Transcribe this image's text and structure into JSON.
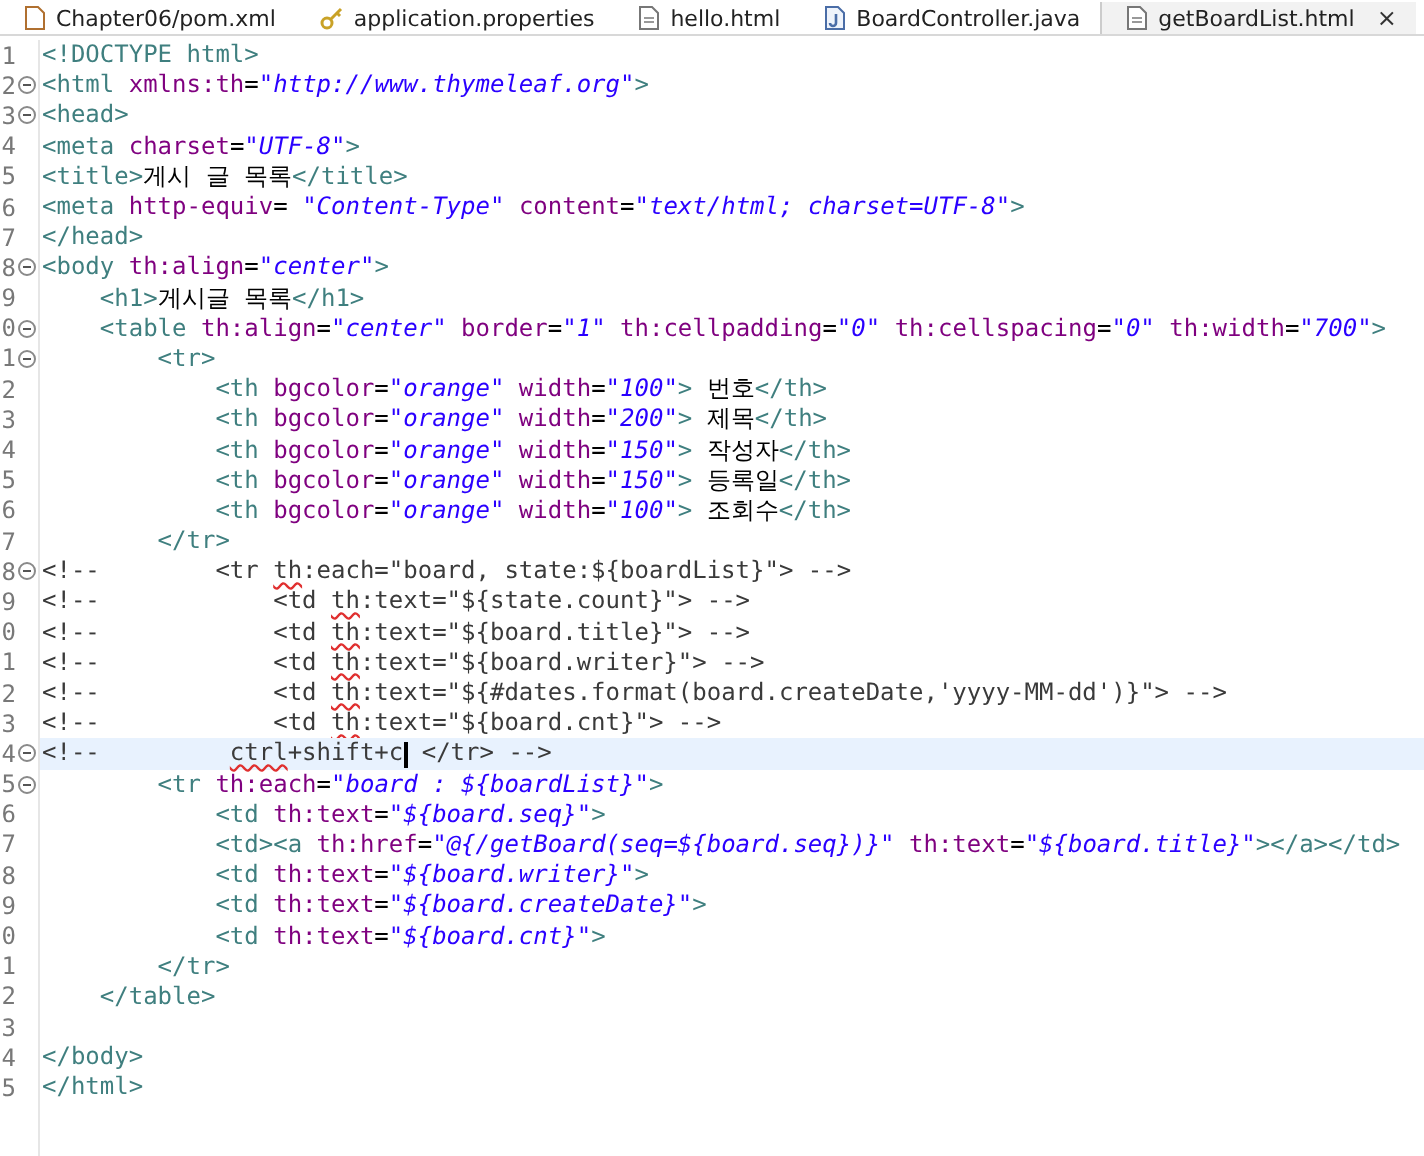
{
  "tabs": [
    {
      "label": "Chapter06/pom.xml",
      "kind": "xml",
      "selected": false
    },
    {
      "label": "application.properties",
      "kind": "properties",
      "selected": false
    },
    {
      "label": "hello.html",
      "kind": "html",
      "selected": false
    },
    {
      "label": "BoardController.java",
      "kind": "java",
      "selected": false
    },
    {
      "label": "getBoardList.html",
      "kind": "html",
      "selected": true,
      "close": "×"
    }
  ],
  "lines": [
    {
      "number": "1",
      "fold": false,
      "current": false,
      "tokens": [
        {
          "kind": "tag",
          "text": "<!DOCTYPE html>"
        }
      ]
    },
    {
      "number": "2",
      "fold": true,
      "current": false,
      "tokens": [
        {
          "kind": "tag",
          "text": "<html "
        },
        {
          "kind": "attr",
          "text": "xmlns:th"
        },
        {
          "kind": "text",
          "text": "="
        },
        {
          "kind": "value",
          "text": "\"http://www.thymeleaf.org\""
        },
        {
          "kind": "tag",
          "text": ">"
        }
      ]
    },
    {
      "number": "3",
      "fold": true,
      "current": false,
      "tokens": [
        {
          "kind": "tag",
          "text": "<head>"
        }
      ]
    },
    {
      "number": "4",
      "fold": false,
      "current": false,
      "tokens": [
        {
          "kind": "tag",
          "text": "<meta "
        },
        {
          "kind": "attr",
          "text": "charset"
        },
        {
          "kind": "text",
          "text": "="
        },
        {
          "kind": "value",
          "text": "\"UTF-8\""
        },
        {
          "kind": "tag",
          "text": ">"
        }
      ]
    },
    {
      "number": "5",
      "fold": false,
      "current": false,
      "tokens": [
        {
          "kind": "tag",
          "text": "<title>"
        },
        {
          "kind": "text",
          "text": "게시 글 목록"
        },
        {
          "kind": "tag",
          "text": "</title>"
        }
      ]
    },
    {
      "number": "6",
      "fold": false,
      "current": false,
      "tokens": [
        {
          "kind": "tag",
          "text": "<meta "
        },
        {
          "kind": "attr",
          "text": "http-equiv"
        },
        {
          "kind": "text",
          "text": "= "
        },
        {
          "kind": "value",
          "text": "\"Content-Type\""
        },
        {
          "kind": "attr",
          "text": " content"
        },
        {
          "kind": "text",
          "text": "="
        },
        {
          "kind": "value",
          "text": "\"text/html; charset=UTF-8\""
        },
        {
          "kind": "tag",
          "text": ">"
        }
      ]
    },
    {
      "number": "7",
      "fold": false,
      "current": false,
      "tokens": [
        {
          "kind": "tag",
          "text": "</head>"
        }
      ]
    },
    {
      "number": "8",
      "fold": true,
      "current": false,
      "tokens": [
        {
          "kind": "tag",
          "text": "<body "
        },
        {
          "kind": "attr",
          "text": "th:align"
        },
        {
          "kind": "text",
          "text": "="
        },
        {
          "kind": "value",
          "text": "\"center\""
        },
        {
          "kind": "tag",
          "text": ">"
        }
      ]
    },
    {
      "number": "9",
      "fold": false,
      "current": false,
      "tokens": [
        {
          "kind": "tag",
          "text": "    <h1>"
        },
        {
          "kind": "text",
          "text": "게시글 목록"
        },
        {
          "kind": "tag",
          "text": "</h1>"
        }
      ]
    },
    {
      "number": "0",
      "fold": true,
      "current": false,
      "tokens": [
        {
          "kind": "tag",
          "text": "    <table "
        },
        {
          "kind": "attr",
          "text": "th:align"
        },
        {
          "kind": "text",
          "text": "="
        },
        {
          "kind": "value",
          "text": "\"center\""
        },
        {
          "kind": "attr",
          "text": " border"
        },
        {
          "kind": "text",
          "text": "="
        },
        {
          "kind": "value",
          "text": "\"1\""
        },
        {
          "kind": "attr",
          "text": " th:cellpadding"
        },
        {
          "kind": "text",
          "text": "="
        },
        {
          "kind": "value",
          "text": "\"0\""
        },
        {
          "kind": "attr",
          "text": " th:cellspacing"
        },
        {
          "kind": "text",
          "text": "="
        },
        {
          "kind": "value",
          "text": "\"0\""
        },
        {
          "kind": "attr",
          "text": " th:width"
        },
        {
          "kind": "text",
          "text": "="
        },
        {
          "kind": "value",
          "text": "\"700\""
        },
        {
          "kind": "tag",
          "text": ">"
        }
      ]
    },
    {
      "number": "1",
      "fold": true,
      "current": false,
      "tokens": [
        {
          "kind": "tag",
          "text": "        <tr>"
        }
      ]
    },
    {
      "number": "2",
      "fold": false,
      "current": false,
      "tokens": [
        {
          "kind": "tag",
          "text": "            <th "
        },
        {
          "kind": "attr",
          "text": "bgcolor"
        },
        {
          "kind": "text",
          "text": "="
        },
        {
          "kind": "value",
          "text": "\"orange\""
        },
        {
          "kind": "attr",
          "text": " width"
        },
        {
          "kind": "text",
          "text": "="
        },
        {
          "kind": "value",
          "text": "\"100\""
        },
        {
          "kind": "tag",
          "text": ">"
        },
        {
          "kind": "text",
          "text": " 번호"
        },
        {
          "kind": "tag",
          "text": "</th>"
        }
      ]
    },
    {
      "number": "3",
      "fold": false,
      "current": false,
      "tokens": [
        {
          "kind": "tag",
          "text": "            <th "
        },
        {
          "kind": "attr",
          "text": "bgcolor"
        },
        {
          "kind": "text",
          "text": "="
        },
        {
          "kind": "value",
          "text": "\"orange\""
        },
        {
          "kind": "attr",
          "text": " width"
        },
        {
          "kind": "text",
          "text": "="
        },
        {
          "kind": "value",
          "text": "\"200\""
        },
        {
          "kind": "tag",
          "text": ">"
        },
        {
          "kind": "text",
          "text": " 제목"
        },
        {
          "kind": "tag",
          "text": "</th>"
        }
      ]
    },
    {
      "number": "4",
      "fold": false,
      "current": false,
      "tokens": [
        {
          "kind": "tag",
          "text": "            <th "
        },
        {
          "kind": "attr",
          "text": "bgcolor"
        },
        {
          "kind": "text",
          "text": "="
        },
        {
          "kind": "value",
          "text": "\"orange\""
        },
        {
          "kind": "attr",
          "text": " width"
        },
        {
          "kind": "text",
          "text": "="
        },
        {
          "kind": "value",
          "text": "\"150\""
        },
        {
          "kind": "tag",
          "text": ">"
        },
        {
          "kind": "text",
          "text": " 작성자"
        },
        {
          "kind": "tag",
          "text": "</th>"
        }
      ]
    },
    {
      "number": "5",
      "fold": false,
      "current": false,
      "tokens": [
        {
          "kind": "tag",
          "text": "            <th "
        },
        {
          "kind": "attr",
          "text": "bgcolor"
        },
        {
          "kind": "text",
          "text": "="
        },
        {
          "kind": "value",
          "text": "\"orange\""
        },
        {
          "kind": "attr",
          "text": " width"
        },
        {
          "kind": "text",
          "text": "="
        },
        {
          "kind": "value",
          "text": "\"150\""
        },
        {
          "kind": "tag",
          "text": ">"
        },
        {
          "kind": "text",
          "text": " 등록일"
        },
        {
          "kind": "tag",
          "text": "</th>"
        }
      ]
    },
    {
      "number": "6",
      "fold": false,
      "current": false,
      "tokens": [
        {
          "kind": "tag",
          "text": "            <th "
        },
        {
          "kind": "attr",
          "text": "bgcolor"
        },
        {
          "kind": "text",
          "text": "="
        },
        {
          "kind": "value",
          "text": "\"orange\""
        },
        {
          "kind": "attr",
          "text": " width"
        },
        {
          "kind": "text",
          "text": "="
        },
        {
          "kind": "value",
          "text": "\"100\""
        },
        {
          "kind": "tag",
          "text": ">"
        },
        {
          "kind": "text",
          "text": " 조회수"
        },
        {
          "kind": "tag",
          "text": "</th>"
        }
      ]
    },
    {
      "number": "7",
      "fold": false,
      "current": false,
      "tokens": [
        {
          "kind": "tag",
          "text": "        </tr>"
        }
      ]
    },
    {
      "number": "8",
      "fold": true,
      "current": false,
      "tokens": [
        {
          "kind": "comment",
          "text": "<!--        <tr "
        },
        {
          "kind": "misspelled",
          "text": "th"
        },
        {
          "kind": "comment",
          "text": ":each=\"board, state:${boardList}\"> -->"
        }
      ]
    },
    {
      "number": "9",
      "fold": false,
      "current": false,
      "tokens": [
        {
          "kind": "comment",
          "text": "<!--            <td "
        },
        {
          "kind": "misspelled",
          "text": "th"
        },
        {
          "kind": "comment",
          "text": ":text=\"${state.count}\"> -->"
        }
      ]
    },
    {
      "number": "0",
      "fold": false,
      "current": false,
      "tokens": [
        {
          "kind": "comment",
          "text": "<!--            <td "
        },
        {
          "kind": "misspelled",
          "text": "th"
        },
        {
          "kind": "comment",
          "text": ":text=\"${board.title}\"> -->"
        }
      ]
    },
    {
      "number": "1",
      "fold": false,
      "current": false,
      "tokens": [
        {
          "kind": "comment",
          "text": "<!--            <td "
        },
        {
          "kind": "misspelled",
          "text": "th"
        },
        {
          "kind": "comment",
          "text": ":text=\"${board.writer}\"> -->"
        }
      ]
    },
    {
      "number": "2",
      "fold": false,
      "current": false,
      "tokens": [
        {
          "kind": "comment",
          "text": "<!--            <td "
        },
        {
          "kind": "misspelled",
          "text": "th"
        },
        {
          "kind": "comment",
          "text": ":text=\"${#dates.format(board.createDate,'yyyy-MM-dd')}\"> -->"
        }
      ]
    },
    {
      "number": "3",
      "fold": false,
      "current": false,
      "tokens": [
        {
          "kind": "comment",
          "text": "<!--            <td "
        },
        {
          "kind": "misspelled",
          "text": "th"
        },
        {
          "kind": "comment",
          "text": ":text=\"${board.cnt}\"> -->"
        }
      ]
    },
    {
      "number": "4",
      "fold": true,
      "current": true,
      "tokens": [
        {
          "kind": "comment",
          "text": "<!--         "
        },
        {
          "kind": "misspelled",
          "text": "ctrl"
        },
        {
          "kind": "comment",
          "text": "+shift+c"
        },
        {
          "kind": "cursor"
        },
        {
          "kind": "comment",
          "text": " </tr> -->"
        }
      ]
    },
    {
      "number": "5",
      "fold": true,
      "current": false,
      "tokens": [
        {
          "kind": "tag",
          "text": "        <tr "
        },
        {
          "kind": "attr",
          "text": "th:each"
        },
        {
          "kind": "text",
          "text": "="
        },
        {
          "kind": "value",
          "text": "\"board : ${boardList}\""
        },
        {
          "kind": "tag",
          "text": ">"
        }
      ]
    },
    {
      "number": "6",
      "fold": false,
      "current": false,
      "tokens": [
        {
          "kind": "tag",
          "text": "            <td "
        },
        {
          "kind": "attr",
          "text": "th:text"
        },
        {
          "kind": "text",
          "text": "="
        },
        {
          "kind": "value",
          "text": "\"${board.seq}\""
        },
        {
          "kind": "tag",
          "text": ">"
        }
      ]
    },
    {
      "number": "7",
      "fold": false,
      "current": false,
      "tokens": [
        {
          "kind": "tag",
          "text": "            <td><a "
        },
        {
          "kind": "attr",
          "text": "th:href"
        },
        {
          "kind": "text",
          "text": "="
        },
        {
          "kind": "value",
          "text": "\"@{/getBoard(seq=${board.seq})}\""
        },
        {
          "kind": "attr",
          "text": " th:text"
        },
        {
          "kind": "text",
          "text": "="
        },
        {
          "kind": "value",
          "text": "\"${board.title}\""
        },
        {
          "kind": "tag",
          "text": "></a></td>"
        }
      ]
    },
    {
      "number": "8",
      "fold": false,
      "current": false,
      "tokens": [
        {
          "kind": "tag",
          "text": "            <td "
        },
        {
          "kind": "attr",
          "text": "th:text"
        },
        {
          "kind": "text",
          "text": "="
        },
        {
          "kind": "value",
          "text": "\"${board.writer}\""
        },
        {
          "kind": "tag",
          "text": ">"
        }
      ]
    },
    {
      "number": "9",
      "fold": false,
      "current": false,
      "tokens": [
        {
          "kind": "tag",
          "text": "            <td "
        },
        {
          "kind": "attr",
          "text": "th:text"
        },
        {
          "kind": "text",
          "text": "="
        },
        {
          "kind": "value",
          "text": "\"${board.createDate}\""
        },
        {
          "kind": "tag",
          "text": ">"
        }
      ]
    },
    {
      "number": "0",
      "fold": false,
      "current": false,
      "tokens": [
        {
          "kind": "tag",
          "text": "            <td "
        },
        {
          "kind": "attr",
          "text": "th:text"
        },
        {
          "kind": "text",
          "text": "="
        },
        {
          "kind": "value",
          "text": "\"${board.cnt}\""
        },
        {
          "kind": "tag",
          "text": ">"
        }
      ]
    },
    {
      "number": "1",
      "fold": false,
      "current": false,
      "tokens": [
        {
          "kind": "tag",
          "text": "        </tr>"
        }
      ]
    },
    {
      "number": "2",
      "fold": false,
      "current": false,
      "tokens": [
        {
          "kind": "tag",
          "text": "    </table>"
        }
      ]
    },
    {
      "number": "3",
      "fold": false,
      "current": false
    },
    {
      "number": "4",
      "fold": false,
      "current": false,
      "tokens": [
        {
          "kind": "tag",
          "text": "</body>"
        }
      ]
    },
    {
      "number": "5",
      "fold": false,
      "current": false,
      "tokens": [
        {
          "kind": "tag",
          "text": "</html>"
        }
      ]
    }
  ]
}
